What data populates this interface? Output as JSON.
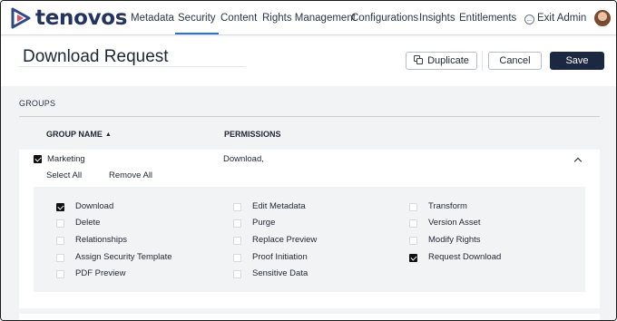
{
  "nav": {
    "brand": "tenovos",
    "items": [
      "Metadata",
      "Security",
      "Content",
      "Rights Management",
      "Configurations",
      "Insights",
      "Entitlements"
    ],
    "active": "Security",
    "exit_label": "Exit Admin"
  },
  "header": {
    "title": "Download Request",
    "duplicate_label": "Duplicate",
    "cancel_label": "Cancel",
    "save_label": "Save"
  },
  "groups": {
    "tab_label": "GROUPS",
    "col_group_name": "GROUP NAME",
    "col_permissions": "PERMISSIONS",
    "row": {
      "name": "Marketing",
      "checked": true,
      "permissions_summary": "Download,",
      "select_all": "Select All",
      "remove_all": "Remove All"
    },
    "permissions": [
      {
        "label": "Download",
        "checked": true
      },
      {
        "label": "Delete",
        "checked": false
      },
      {
        "label": "Relationships",
        "checked": false
      },
      {
        "label": "Assign Security Template",
        "checked": false
      },
      {
        "label": "PDF Preview",
        "checked": false
      },
      {
        "label": "Edit Metadata",
        "checked": false
      },
      {
        "label": "Purge",
        "checked": false
      },
      {
        "label": "Replace Preview",
        "checked": false
      },
      {
        "label": "Proof Initiation",
        "checked": false
      },
      {
        "label": "Sensitive Data",
        "checked": false
      },
      {
        "label": "Transform",
        "checked": false
      },
      {
        "label": "Version Asset",
        "checked": false
      },
      {
        "label": "Modify Rights",
        "checked": false
      },
      {
        "label": "Request Download",
        "checked": true
      }
    ]
  },
  "colors": {
    "brand": "#23355f",
    "accent": "#2d72d2",
    "primary_button": "#1c2842"
  }
}
